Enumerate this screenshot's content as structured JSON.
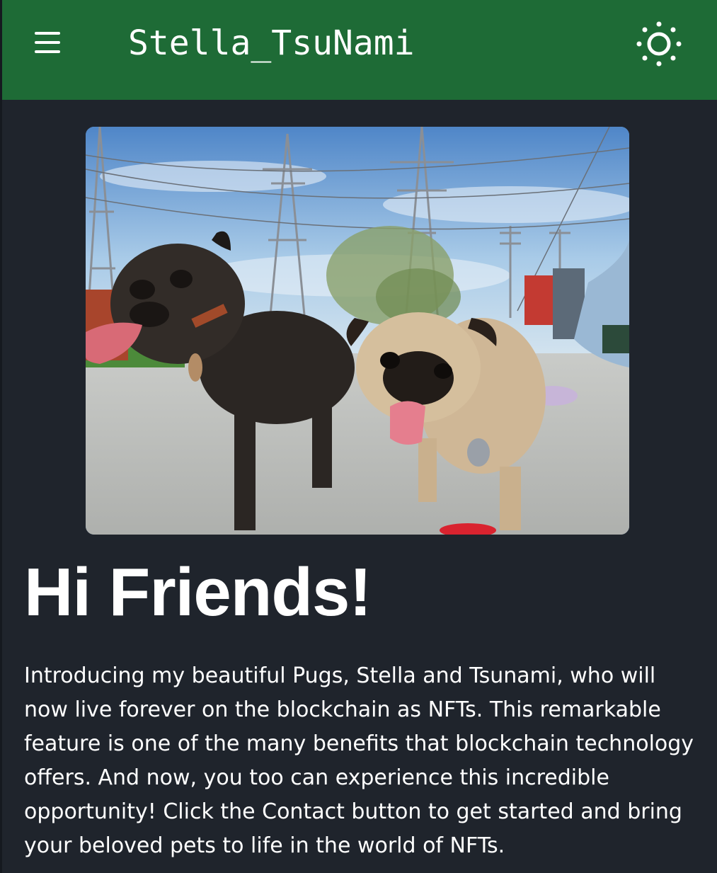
{
  "header": {
    "title": "Stella_TsuNami",
    "menu_icon": "hamburger-menu-icon",
    "theme_icon": "sun-icon"
  },
  "hero": {
    "description": "photo of two pugs at a dog park"
  },
  "content": {
    "heading": "Hi Friends!",
    "intro": "Introducing my beautiful Pugs, Stella and Tsunami, who will now live forever on the blockchain as NFTs. This remarkable feature is one of the many benefits that blockchain technology offers. And now, you too can experience this incredible opportunity! Click the Contact button to get started and bring your beloved pets to life in the world of NFTs."
  },
  "colors": {
    "appbar": "#1e6b36",
    "background": "#1f242c",
    "text": "#ffffff"
  }
}
